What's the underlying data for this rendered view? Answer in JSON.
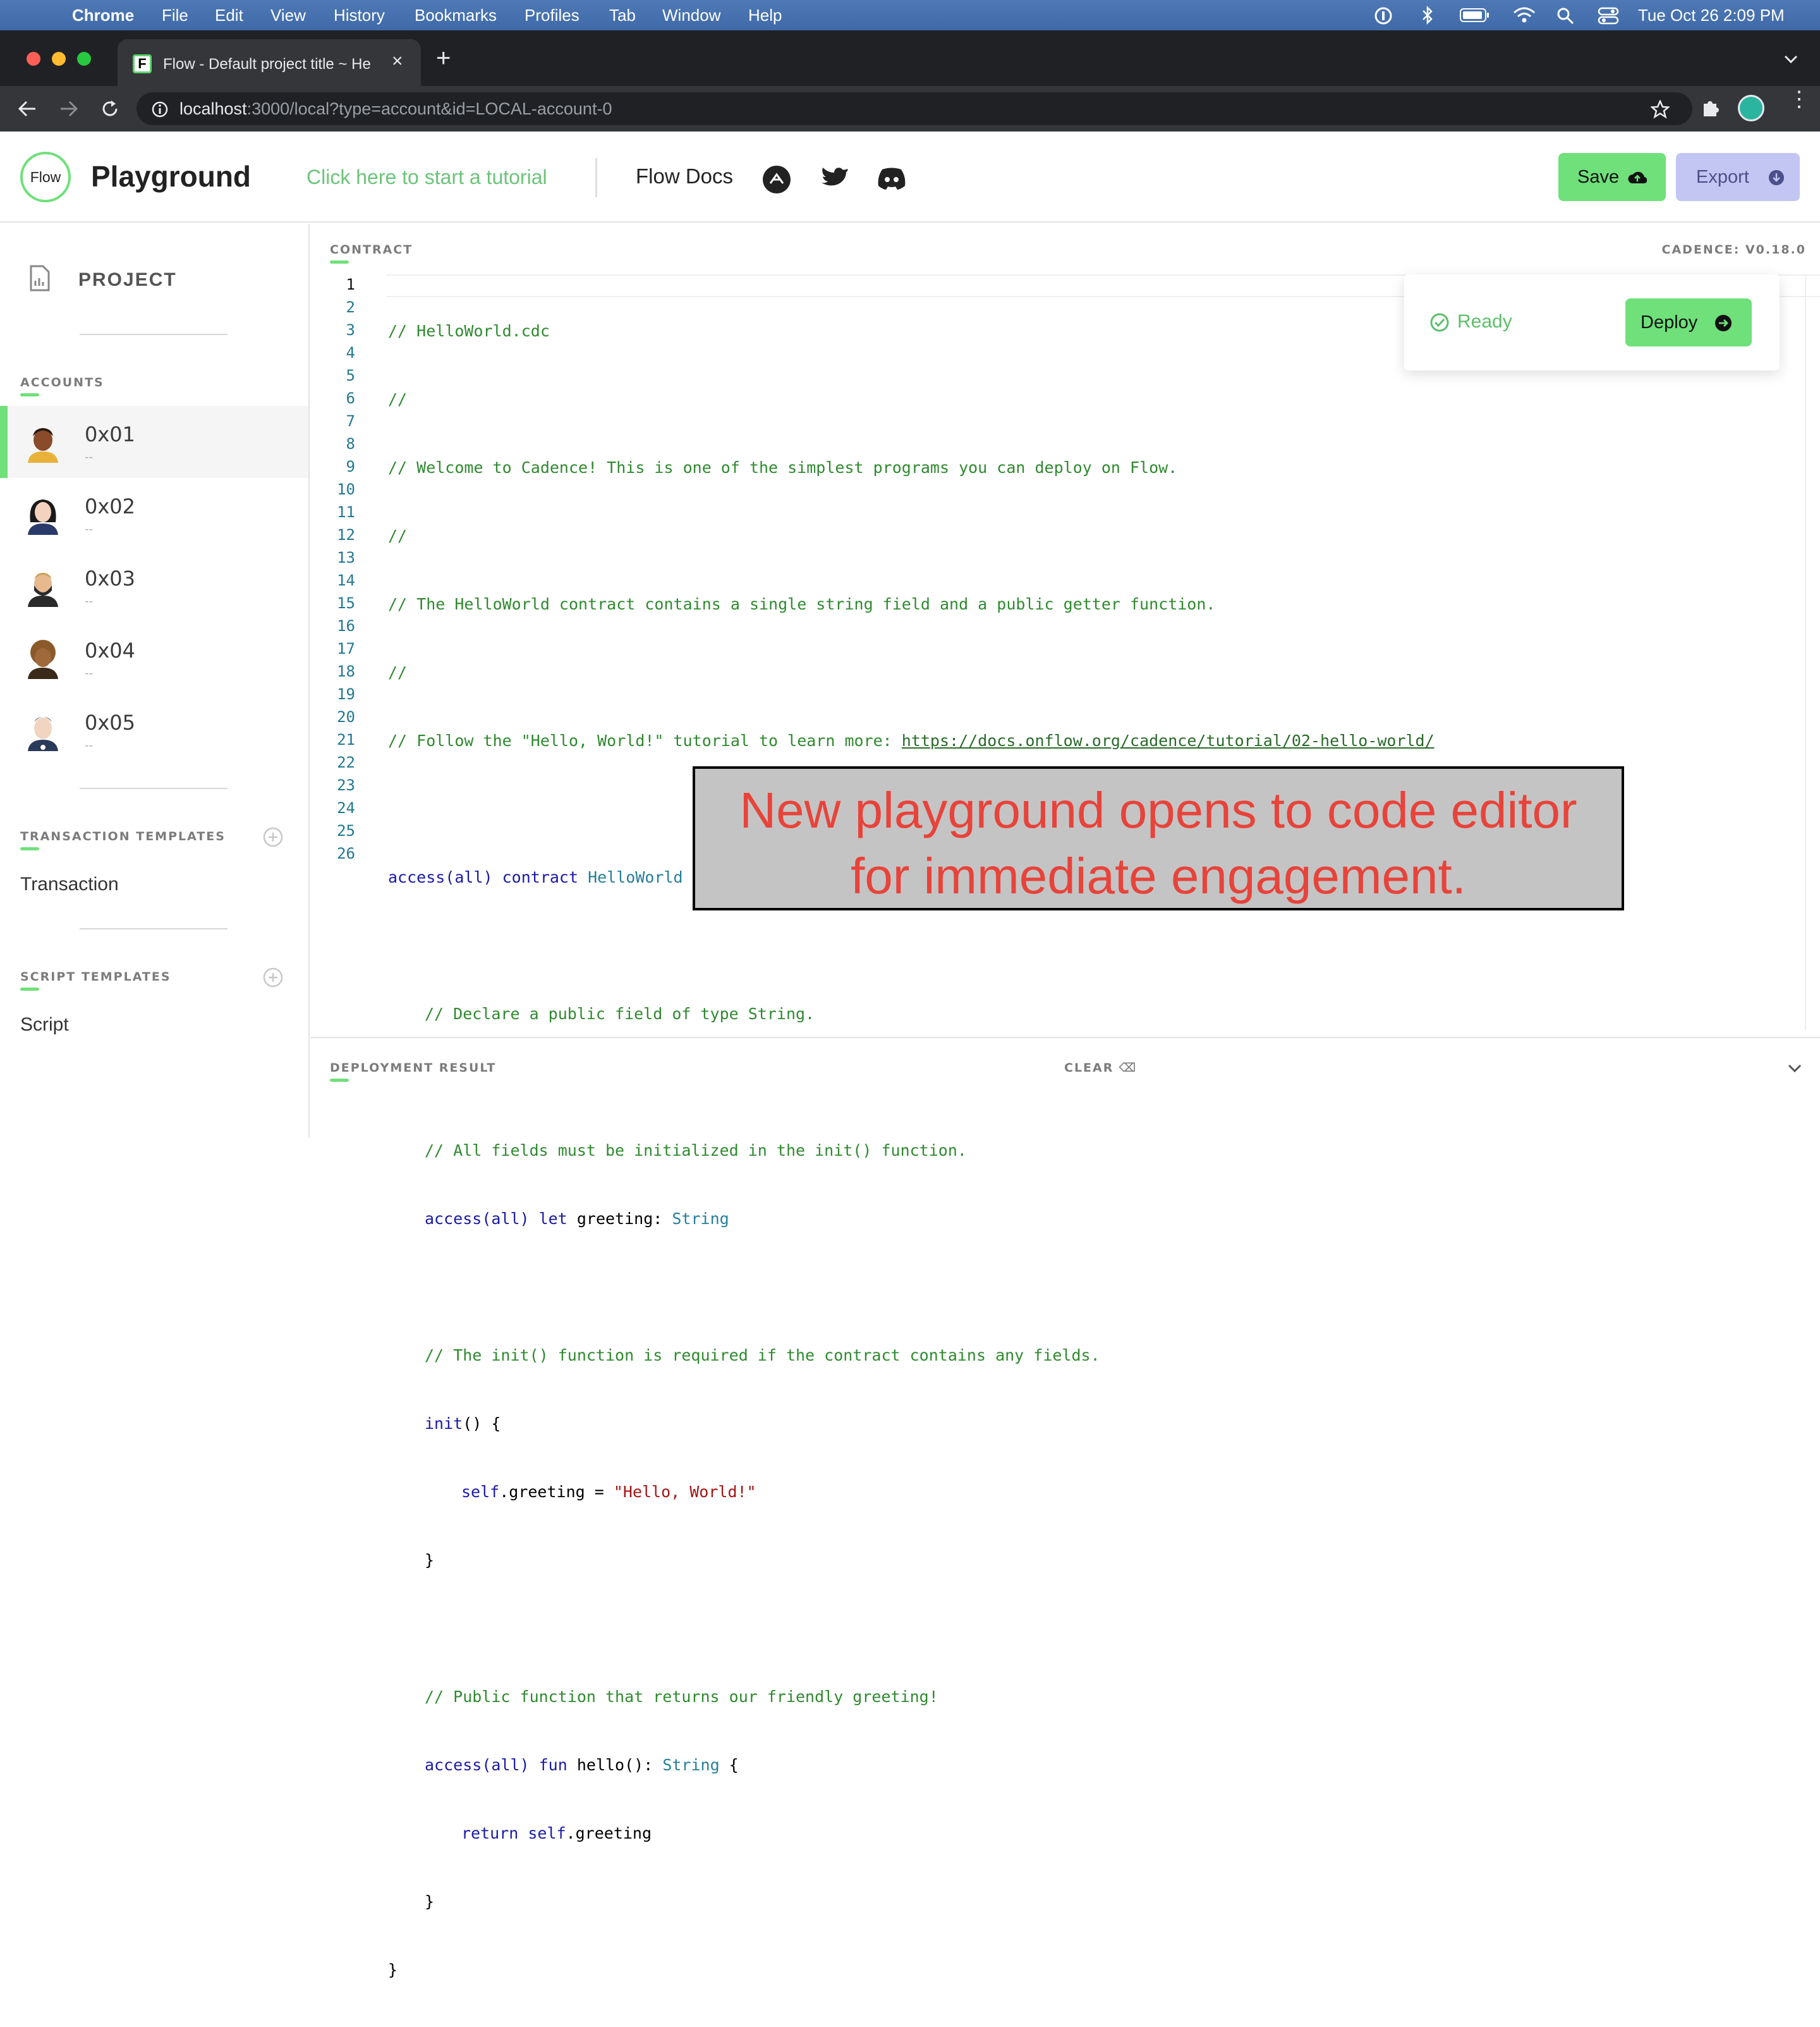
{
  "menubar": {
    "apple": "",
    "app": "Chrome",
    "items": [
      "File",
      "Edit",
      "View",
      "History",
      "Bookmarks",
      "Profiles",
      "Tab",
      "Window",
      "Help"
    ],
    "datetime": "Tue Oct 26  2:09 PM"
  },
  "browser": {
    "tab_title": "Flow - Default project title ~ Hello",
    "url_host": "localhost",
    "url_rest": ":3000/local?type=account&id=LOCAL-account-0"
  },
  "header": {
    "logo": "Flow",
    "title": "Playground",
    "tutorial": "Click here to start a tutorial",
    "docs": "Flow Docs",
    "save": "Save",
    "export": "Export"
  },
  "sidebar": {
    "project": "PROJECT",
    "accounts_label": "ACCOUNTS",
    "accounts": [
      {
        "name": "0x01",
        "sub": "--"
      },
      {
        "name": "0x02",
        "sub": "--"
      },
      {
        "name": "0x03",
        "sub": "--"
      },
      {
        "name": "0x04",
        "sub": "--"
      },
      {
        "name": "0x05",
        "sub": "--"
      }
    ],
    "tx_label": "TRANSACTION TEMPLATES",
    "tx_item": "Transaction",
    "script_label": "SCRIPT TEMPLATES",
    "script_item": "Script"
  },
  "editor": {
    "section": "CONTRACT",
    "version": "CADENCE: V0.18.0",
    "status": "Ready",
    "deploy": "Deploy",
    "code": {
      "l1": "// HelloWorld.cdc",
      "l2": "//",
      "l3": "// Welcome to Cadence! This is one of the simplest programs you can deploy on Flow.",
      "l4": "//",
      "l5": "// The HelloWorld contract contains a single string field and a public getter function.",
      "l6": "//",
      "l7a": "// Follow the \"Hello, World!\" tutorial to learn more: ",
      "l7b": "https://docs.onflow.org/cadence/tutorial/02-hello-world/",
      "l9a": "access",
      "l9b": "(all)",
      "l9c": " contract ",
      "l9d": "HelloWorld",
      "l9e": " {",
      "l11": "// Declare a public field of type String.",
      "l12": "//",
      "l13": "// All fields must be initialized in the init() function.",
      "l14a": "access",
      "l14b": "(all)",
      "l14c": " let ",
      "l14d": "greeting: ",
      "l14e": "String",
      "l16": "// The init() function is required if the contract contains any fields.",
      "l17a": "init",
      "l17b": "() {",
      "l18a": "self",
      "l18b": ".greeting = ",
      "l18c": "\"Hello, World!\"",
      "l19": "}",
      "l21": "// Public function that returns our friendly greeting!",
      "l22a": "access",
      "l22b": "(all)",
      "l22c": " fun ",
      "l22d": "hello(): ",
      "l22e": "String",
      "l22f": " {",
      "l23a": "return ",
      "l23b": "self",
      "l23c": ".greeting",
      "l24": "}",
      "l25": "}"
    },
    "line_numbers": [
      "1",
      "2",
      "3",
      "4",
      "5",
      "6",
      "7",
      "8",
      "9",
      "10",
      "11",
      "12",
      "13",
      "14",
      "15",
      "16",
      "17",
      "18",
      "19",
      "20",
      "21",
      "22",
      "23",
      "24",
      "25",
      "26"
    ]
  },
  "overlay": {
    "line1": "New playground opens to code editor",
    "line2": "for immediate engagement."
  },
  "results": {
    "title": "DEPLOYMENT RESULT",
    "clear": "CLEAR"
  },
  "colors": {
    "accent": "#6fe07a",
    "export": "#c3c6f2",
    "overlay_text": "#e8433a",
    "overlay_bg": "#c4c4c4"
  }
}
